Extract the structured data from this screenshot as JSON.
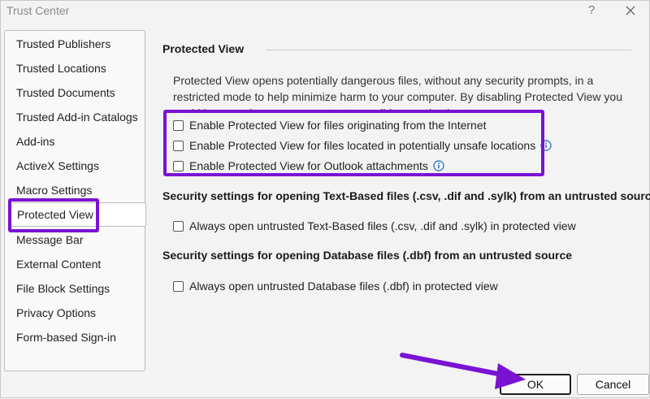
{
  "window": {
    "title": "Trust Center",
    "help_label": "?"
  },
  "sidebar": {
    "items": [
      {
        "label": "Trusted Publishers"
      },
      {
        "label": "Trusted Locations"
      },
      {
        "label": "Trusted Documents"
      },
      {
        "label": "Trusted Add-in Catalogs"
      },
      {
        "label": "Add-ins"
      },
      {
        "label": "ActiveX Settings"
      },
      {
        "label": "Macro Settings"
      },
      {
        "label": "Protected View",
        "selected": true
      },
      {
        "label": "Message Bar"
      },
      {
        "label": "External Content"
      },
      {
        "label": "File Block Settings"
      },
      {
        "label": "Privacy Options"
      },
      {
        "label": "Form-based Sign-in"
      }
    ]
  },
  "main": {
    "protected_view": {
      "heading": "Protected View",
      "description": "Protected View opens potentially dangerous files, without any security prompts, in a restricted mode to help minimize harm to your computer. By disabling Protected View you could be exposing your computer to possible security threats.",
      "options": [
        {
          "label": "Enable Protected View for files originating from the Internet",
          "checked": false,
          "info": false
        },
        {
          "label": "Enable Protected View for files located in potentially unsafe locations",
          "checked": false,
          "info": true
        },
        {
          "label": "Enable Protected View for Outlook attachments",
          "checked": false,
          "info": true
        }
      ]
    },
    "text_based": {
      "heading": "Security settings for opening Text-Based files (.csv, .dif and .sylk) from an untrusted source",
      "option": {
        "label": "Always open untrusted Text-Based files (.csv, .dif and .sylk) in protected view",
        "checked": false
      }
    },
    "database": {
      "heading": "Security settings for opening Database files (.dbf) from an untrusted source",
      "option": {
        "label": "Always open untrusted Database files (.dbf) in protected view",
        "checked": false
      }
    }
  },
  "footer": {
    "ok_label": "OK",
    "cancel_label": "Cancel"
  },
  "colors": {
    "annotation": "#7a12d4"
  }
}
